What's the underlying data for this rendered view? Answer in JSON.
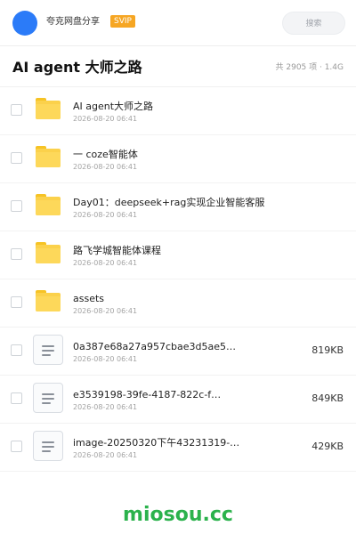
{
  "header": {
    "app_name": "夸克网盘分享",
    "vip_label": "SVIP",
    "search_placeholder": "搜索",
    "avatar_color": "#2b7bf8"
  },
  "folder": {
    "title": "AI agent 大师之路",
    "count_text": "共 2905 项 · 1.4G"
  },
  "files": [
    {
      "type": "folder",
      "name": "AI agent大师之路",
      "date": "2026-08-20 06:41",
      "size": ""
    },
    {
      "type": "folder",
      "name": "一 coze智能体",
      "date": "2026-08-20 06:41",
      "size": ""
    },
    {
      "type": "folder",
      "name": "Day01：deepseek+rag实现企业智能客服",
      "date": "2026-08-20 06:41",
      "size": ""
    },
    {
      "type": "folder",
      "name": "路飞学城智能体课程",
      "date": "2026-08-20 06:41",
      "size": ""
    },
    {
      "type": "folder",
      "name": "assets",
      "date": "2026-08-20 06:41",
      "size": ""
    },
    {
      "type": "file",
      "name": "0a387e68a27a957cbae3d5ae5…",
      "date": "2026-08-20 06:41",
      "size": "819KB"
    },
    {
      "type": "file",
      "name": "e3539198-39fe-4187-822c-f…",
      "date": "2026-08-20 06:41",
      "size": "849KB"
    },
    {
      "type": "file",
      "name": "image-20250320下午43231319-…",
      "date": "2026-08-20 06:41",
      "size": "429KB"
    }
  ],
  "icons": {
    "folder": "folder-icon",
    "file": "document-icon"
  },
  "watermark": "miosou.cc",
  "colors": {
    "folder": "#fbd14b",
    "vip": "#f6a623",
    "watermark": "#2bb24c"
  }
}
